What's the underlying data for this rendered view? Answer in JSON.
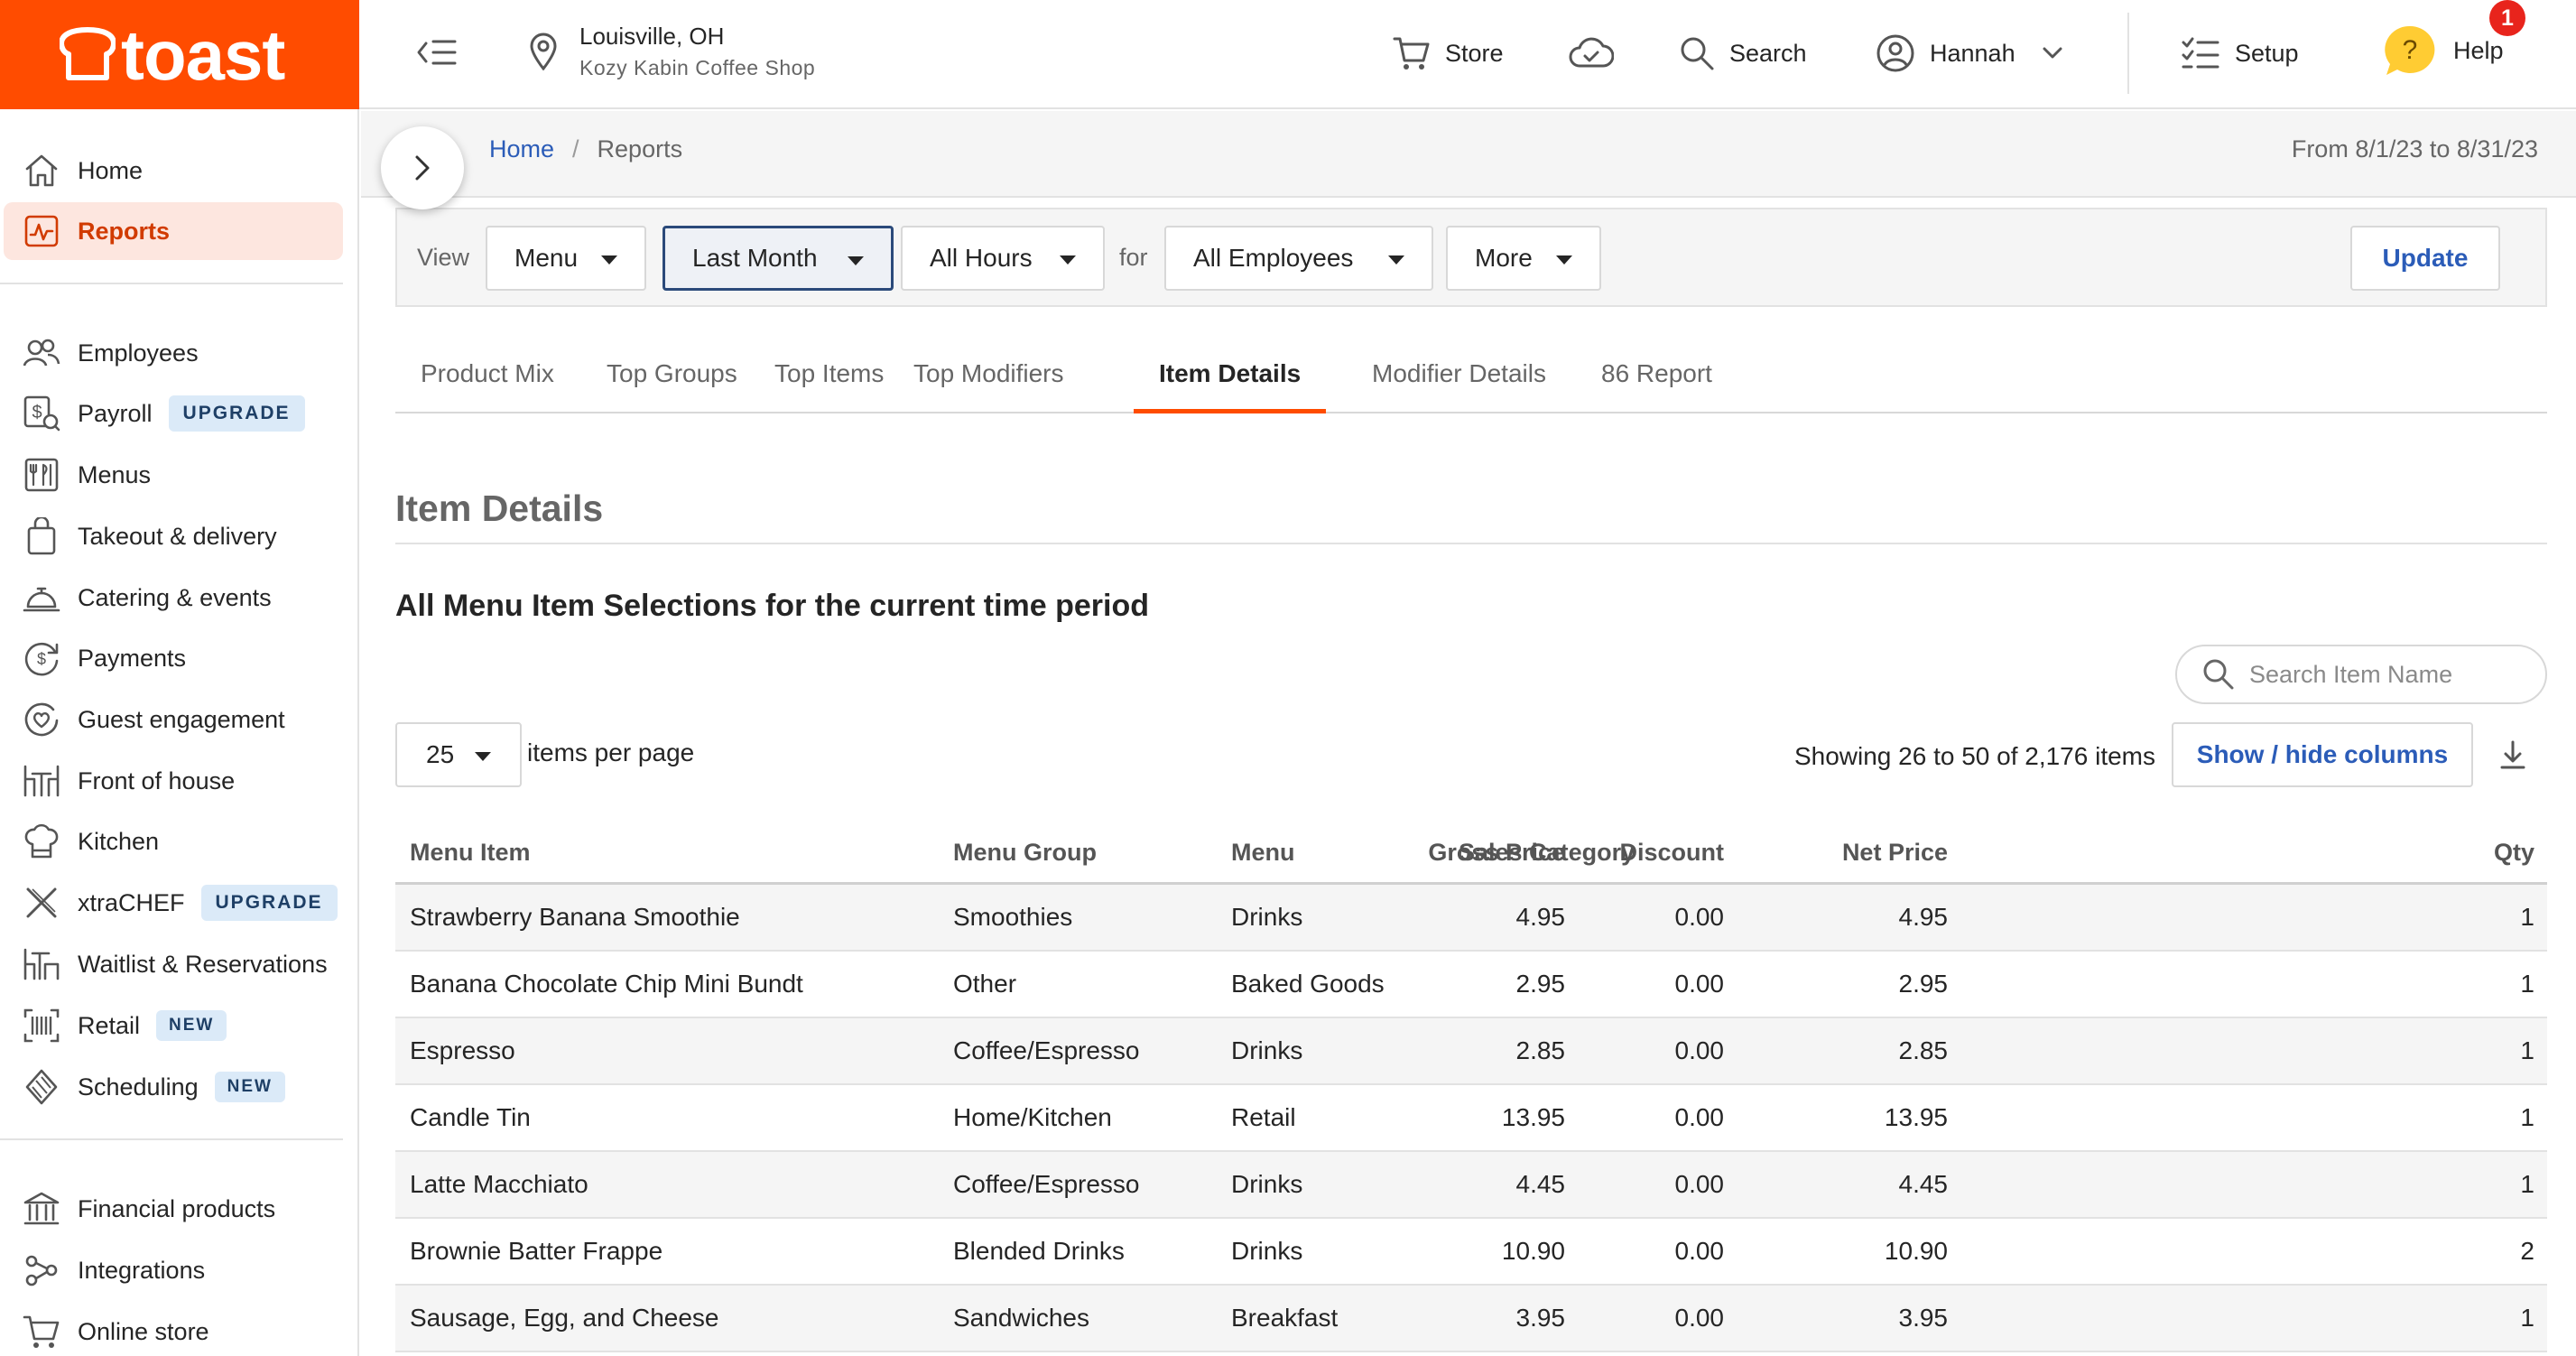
{
  "brand": {
    "logo_text": "toast",
    "accent": "#ff4c00"
  },
  "topbar": {
    "location_city": "Louisville, OH",
    "location_shop": "Kozy Kabin Coffee Shop",
    "store_label": "Store",
    "search_label": "Search",
    "user_label": "Hannah",
    "setup_label": "Setup",
    "help_label": "Help",
    "help_badge": "1",
    "help_glyph": "?"
  },
  "sidebar": {
    "home": "Home",
    "reports": "Reports",
    "employees": "Employees",
    "payroll": "Payroll",
    "payroll_badge": "UPGRADE",
    "menus": "Menus",
    "takeout": "Takeout & delivery",
    "catering": "Catering & events",
    "payments": "Payments",
    "guest": "Guest engagement",
    "front": "Front of house",
    "kitchen": "Kitchen",
    "xtrachef": "xtraCHEF",
    "xtrachef_badge": "UPGRADE",
    "waitlist": "Waitlist & Reservations",
    "retail": "Retail",
    "retail_badge": "NEW",
    "scheduling": "Scheduling",
    "scheduling_badge": "NEW",
    "financial": "Financial products",
    "integrations": "Integrations",
    "online_store": "Online store"
  },
  "breadcrumb": {
    "home": "Home",
    "separator": "/",
    "current": "Reports"
  },
  "date_range": "From 8/1/23 to 8/31/23",
  "filters": {
    "view_label": "View",
    "view_value": "Menu",
    "period_value": "Last Month",
    "hours_value": "All Hours",
    "for_label": "for",
    "employees_value": "All Employees",
    "more_value": "More",
    "update_label": "Update"
  },
  "tabs": [
    "Product Mix",
    "Top Groups",
    "Top Items",
    "Top Modifiers",
    "Item Details",
    "Modifier Details",
    "86 Report"
  ],
  "content": {
    "heading": "Item Details",
    "subheading": "All Menu Item Selections for the current time period",
    "search_placeholder": "Search Item Name",
    "per_page_value": "25",
    "per_page_label": "items per page",
    "showing_text": "Showing 26 to 50 of 2,176 items",
    "show_hide_label": "Show / hide columns"
  },
  "table": {
    "columns": [
      "Menu Item",
      "Menu Group",
      "Menu",
      "Sales Category",
      "Gross Price",
      "Discount",
      "Net Price",
      "Qty"
    ],
    "rows": [
      [
        "Strawberry Banana Smoothie",
        "Smoothies",
        "Drinks",
        "",
        "4.95",
        "0.00",
        "4.95",
        "1"
      ],
      [
        "Banana Chocolate Chip Mini Bundt",
        "Other",
        "Baked Goods",
        "",
        "2.95",
        "0.00",
        "2.95",
        "1"
      ],
      [
        "Espresso",
        "Coffee/Espresso",
        "Drinks",
        "",
        "2.85",
        "0.00",
        "2.85",
        "1"
      ],
      [
        "Candle Tin",
        "Home/Kitchen",
        "Retail",
        "",
        "13.95",
        "0.00",
        "13.95",
        "1"
      ],
      [
        "Latte Macchiato",
        "Coffee/Espresso",
        "Drinks",
        "",
        "4.45",
        "0.00",
        "4.45",
        "1"
      ],
      [
        "Brownie Batter Frappe",
        "Blended Drinks",
        "Drinks",
        "",
        "10.90",
        "0.00",
        "10.90",
        "2"
      ],
      [
        "Sausage, Egg, and Cheese",
        "Sandwiches",
        "Breakfast",
        "",
        "3.95",
        "0.00",
        "3.95",
        "1"
      ]
    ]
  }
}
